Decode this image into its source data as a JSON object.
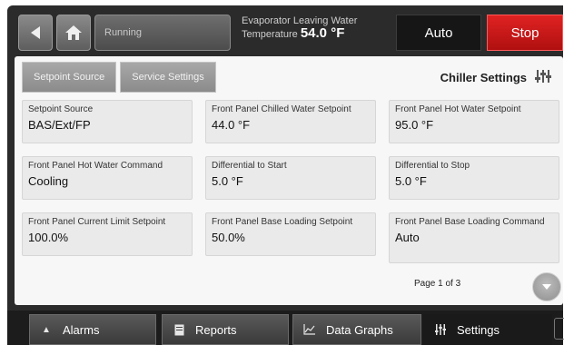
{
  "header": {
    "status_text": "Running",
    "evap_label": "Evaporator Leaving Water",
    "evap_prefix": "Temperature",
    "evap_value": "54.0 °F",
    "auto_label": "Auto",
    "stop_label": "Stop",
    "stop_color": "#d41717"
  },
  "tabs": [
    {
      "label": "Setpoint Source"
    },
    {
      "label": "Service Settings"
    }
  ],
  "panel": {
    "title": "Chiller Settings",
    "page_info": "Page 1 of 3"
  },
  "settings": [
    {
      "label": "Setpoint Source",
      "value": "BAS/Ext/FP"
    },
    {
      "label": "Front Panel Chilled Water Setpoint",
      "value": "44.0 °F"
    },
    {
      "label": "Front Panel Hot Water Setpoint",
      "value": "95.0 °F"
    },
    {
      "label": "Front Panel Hot Water Command",
      "value": "Cooling"
    },
    {
      "label": "Differential to Start",
      "value": "5.0 °F"
    },
    {
      "label": "Differential to Stop",
      "value": "5.0 °F"
    },
    {
      "label": "Front Panel Current Limit Setpoint",
      "value": "100.0%"
    },
    {
      "label": "Front Panel Base Loading Setpoint",
      "value": "50.0%"
    },
    {
      "label": "Front Panel Base Loading Command",
      "value": "Auto"
    }
  ],
  "nav": [
    {
      "label": "Alarms",
      "icon": "bell-icon"
    },
    {
      "label": "Reports",
      "icon": "report-icon"
    },
    {
      "label": "Data Graphs",
      "icon": "graph-icon"
    },
    {
      "label": "Settings",
      "icon": "settings-icon"
    }
  ]
}
